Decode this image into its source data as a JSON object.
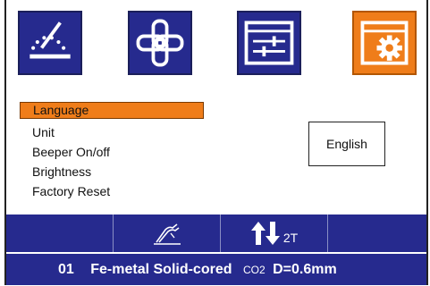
{
  "icons": {
    "tile1": "welding-mode-icon",
    "tile2": "wire-link-icon",
    "tile3": "adjust-sliders-icon",
    "tile4": "system-settings-icon"
  },
  "colors": {
    "navy": "#262a8e",
    "accent": "#ef7d1a",
    "text": "#111111",
    "background": "#ffffff"
  },
  "menu": {
    "items": [
      "Language",
      "Unit",
      "Beeper On/off",
      "Brightness",
      "Factory Reset"
    ],
    "selected_index": 0
  },
  "value_box": {
    "value": "English"
  },
  "toolbar": {
    "cell2_icon": "torch-icon",
    "cell3_icon": "up-down-arrows-icon",
    "mode_label": "2T"
  },
  "status_bar": {
    "program_number": "01",
    "material": "Fe-metal Solid-cored",
    "gas": "CO2",
    "wire": "D=0.6mm"
  }
}
